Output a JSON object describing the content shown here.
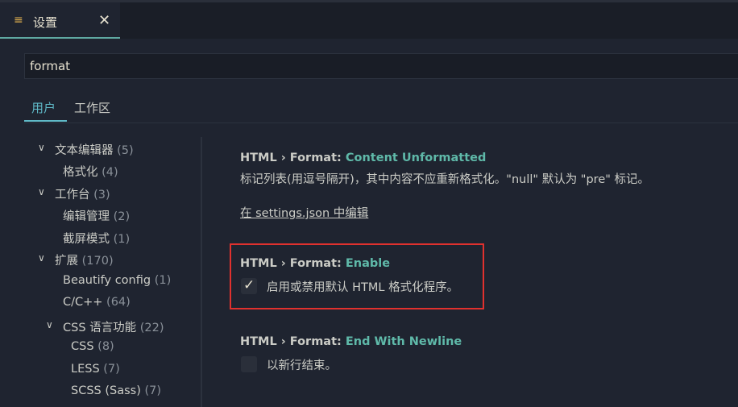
{
  "tab": {
    "icon": "settings-list-icon",
    "title": "设置",
    "close": "✕"
  },
  "search": {
    "value": "format"
  },
  "scope": {
    "user": "用户",
    "workspace": "工作区"
  },
  "toc": [
    {
      "label": "文本编辑器",
      "count": "(5)",
      "expanded": true
    },
    {
      "label": "格式化",
      "count": "(4)"
    },
    {
      "label": "工作台",
      "count": "(3)",
      "expanded": true
    },
    {
      "label": "编辑管理",
      "count": "(2)"
    },
    {
      "label": "截屏模式",
      "count": "(1)"
    },
    {
      "label": "扩展",
      "count": "(170)",
      "expanded": true
    },
    {
      "label": "Beautify config",
      "count": "(1)"
    },
    {
      "label": "C/C++",
      "count": "(64)"
    },
    {
      "label": "CSS 语言功能",
      "count": "(22)",
      "expanded": true
    },
    {
      "label": "CSS",
      "count": "(8)"
    },
    {
      "label": "LESS",
      "count": "(7)"
    },
    {
      "label": "SCSS (Sass)",
      "count": "(7)"
    }
  ],
  "settings": [
    {
      "prefix": "HTML › Format: ",
      "key": "Content Unformatted",
      "description": "标记列表(用逗号隔开)，其中内容不应重新格式化。\"null\" 默认为 \"pre\" 标记。",
      "link": "在 settings.json 中编辑"
    },
    {
      "prefix": "HTML › Format: ",
      "key": "Enable",
      "checkbox_label": "启用或禁用默认 HTML 格式化程序。",
      "checked": true
    },
    {
      "prefix": "HTML › Format: ",
      "key": "End With Newline",
      "checkbox_label": "以新行结束。",
      "checked": false
    }
  ],
  "colors": {
    "background": "#1f2430",
    "accent": "#5fb9c7",
    "setting_key": "#5fb9a9",
    "highlight_border": "#e0312e"
  }
}
